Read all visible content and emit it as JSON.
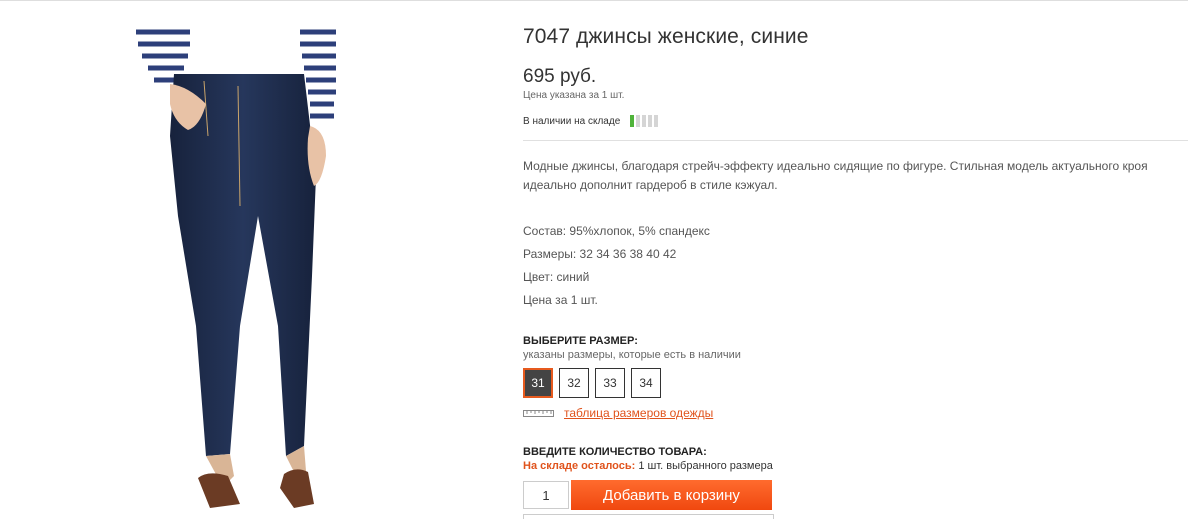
{
  "product": {
    "title": "7047 джинсы женские, синие",
    "price": "695 руб.",
    "price_note": "Цена указана за 1 шт.",
    "stock_label": "В наличии на складе",
    "stock_level": 0.2,
    "stock_color": "#4fb33a",
    "description": "Модные джинсы, благодаря стрейч-эффекту идеально сидящие по фигуре. Стильная модель актуального кроя идеально дополнит гардероб в стиле кэжуал."
  },
  "specs": {
    "composition": "Состав: 95%хлопок, 5% спандекс",
    "sizes": "Размеры: 32 34 36 38 40 42",
    "color": "Цвет: синий",
    "price_per": "Цена за 1 шт."
  },
  "size_select": {
    "heading": "ВЫБЕРИТЕ РАЗМЕР:",
    "hint": "указаны размеры, которые есть в наличии",
    "options": [
      "31",
      "32",
      "33",
      "34"
    ],
    "selected": "31",
    "size_table_link": "таблица размеров одежды",
    "ruler_icon": "ruler-icon"
  },
  "quantity": {
    "heading": "ВВЕДИТЕ КОЛИЧЕСТВО ТОВАРА:",
    "stock_left_label": "На складе осталось:",
    "stock_left_text": " 1 шт. выбранного размера",
    "value": "1",
    "add_to_cart_label": "Добавить в корзину"
  },
  "colors": {
    "accent": "#e0531c",
    "button": "#f0480f",
    "denim": "#1e2d4d"
  }
}
